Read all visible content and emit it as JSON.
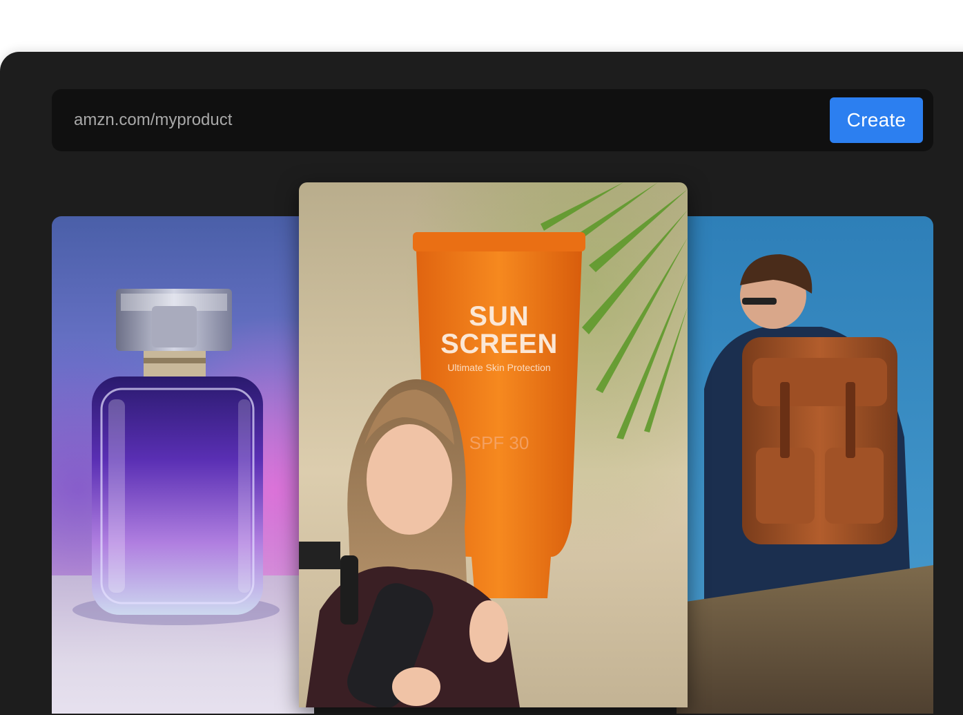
{
  "url_bar": {
    "value": "amzn.com/myproduct",
    "create_label": "Create"
  },
  "cards": {
    "center": {
      "product_title_line1": "SUN",
      "product_title_line2": "SCREEN",
      "product_tagline": "Ultimate Skin Protection",
      "product_spf": "SPF 30"
    }
  },
  "colors": {
    "frame": "#1d1d1d",
    "url_bar": "#101010",
    "accent": "#2c7ff0",
    "tube": "#f07a1a"
  }
}
